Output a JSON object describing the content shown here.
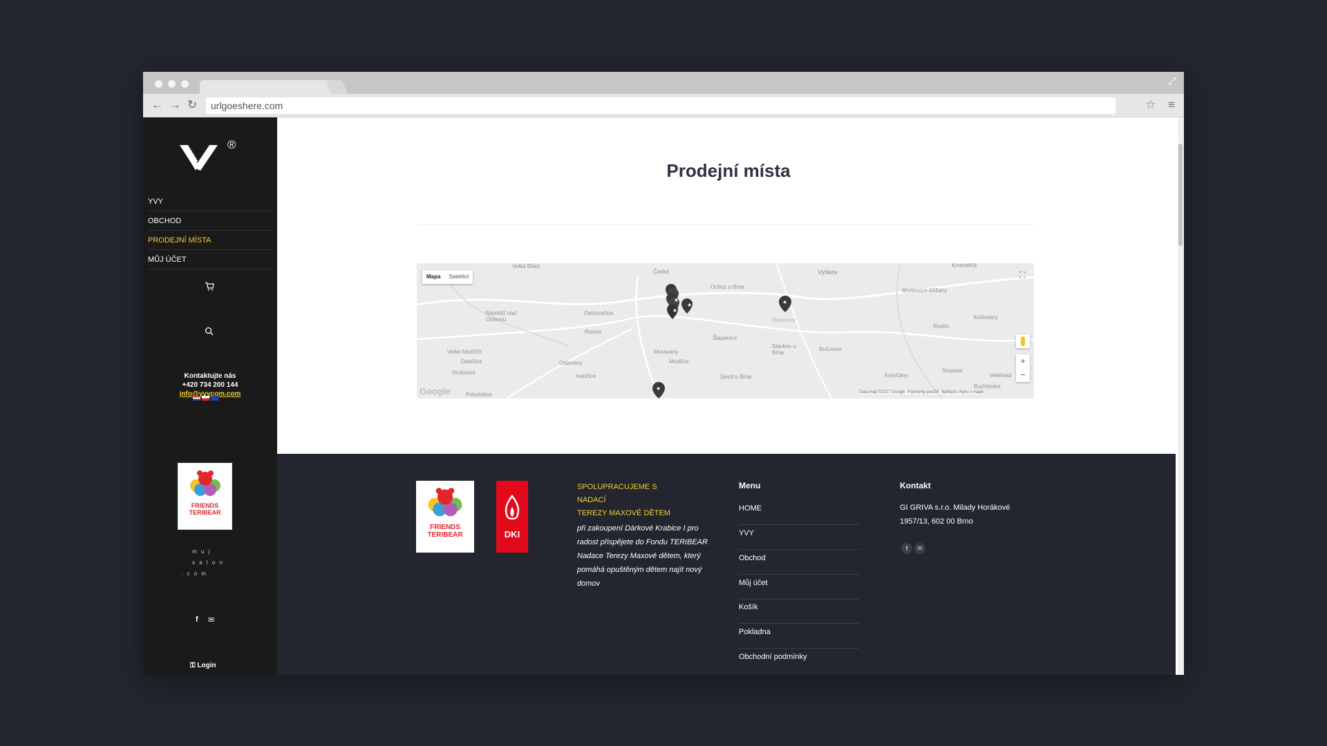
{
  "browser": {
    "url": "urlgoeshere.com",
    "back_icon": "arrow-left-icon",
    "forward_icon": "arrow-right-icon",
    "reload_icon": "reload-icon",
    "bookmark_icon": "star-icon",
    "menu_icon": "hamburger-icon",
    "fullscreen_icon": "expand-icon"
  },
  "sidebar": {
    "logo_mark": "®",
    "menu": [
      {
        "label": "YVY",
        "active": false
      },
      {
        "label": "OBCHOD",
        "active": false
      },
      {
        "label": "PRODEJNÍ MÍSTA",
        "active": true
      },
      {
        "label": "MŮJ ÚČET",
        "active": false
      }
    ],
    "contact": {
      "heading": "Kontaktujte nás",
      "phone": "+420 734 200 144",
      "email": "info@yvycom.com"
    },
    "teribear_logo": {
      "line1": "FRIENDS",
      "line2": "TERIBEAR"
    },
    "brand_letters": {
      "line1": "m u j",
      "line2": "s a l o n",
      "line3": ". c o m"
    },
    "login_label": "Login",
    "accent": "#f2cf2f"
  },
  "main": {
    "title": "Prodejní místa",
    "map": {
      "type_buttons": [
        "Mapa",
        "Satelitní"
      ],
      "places": [
        "Velká Bíteš",
        "Česká",
        "Ochoz u Brna",
        "Vyškov",
        "Kroměříž",
        "Náměšť nad Oslavou",
        "Ostrovačice",
        "Rosice",
        "Šlapanice",
        "Rousínov",
        "Morkovice-Slížany",
        "Rostín",
        "Koštelany",
        "Velké Meziříčí",
        "Dalešice",
        "Hrotovice",
        "Oslavany",
        "Ivančice",
        "Modřice",
        "Moravany",
        "Slavkov u Brna",
        "Bučovice",
        "Újezd u Brna",
        "Koryčany",
        "Stupava",
        "Velehrad",
        "Buchlovice",
        "Pohořelice"
      ],
      "zoom_in": "+",
      "zoom_out": "−",
      "attribution": "Data map ©2017 Google",
      "terms": "Podmínky použití",
      "report": "Nahlásit chybu v mapě",
      "google": "Google",
      "pin_count": 9
    }
  },
  "footer": {
    "partner_heading_1": "SPOLUPRACUJEME S NADACÍ",
    "partner_heading_2": "TEREZY MAXOVÉ DĚTEM",
    "partner_text": "při zakoupení Dárkové Krabice I pro radost přispějete do Fondu TERIBEAR Nadace Terezy Maxové dětem, který pomáhá opuštěným dětem najít nový domov",
    "dki_label": "DKI",
    "menu_heading": "Menu",
    "menu_items": [
      "HOME",
      "YVY",
      "Obchod",
      "Můj účet",
      "Košík",
      "Pokladna",
      "Obchodní podmínky"
    ],
    "contact_heading": "Kontakt",
    "address_line1": "GI GRIVA s.r.o. Milady Horákové",
    "address_line2": "1957/13, 602 00 Brno",
    "social_icons": [
      "facebook-icon",
      "mail-icon"
    ]
  }
}
